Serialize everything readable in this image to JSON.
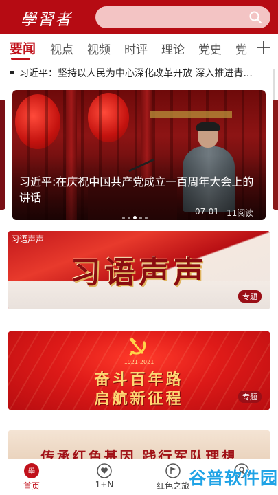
{
  "header": {
    "logo_text": "學習者",
    "search": {
      "placeholder": ""
    }
  },
  "tabs": [
    "要闻",
    "视点",
    "视频",
    "时评",
    "理论",
    "党史",
    "党"
  ],
  "active_tab": 0,
  "ticker": {
    "text": "习近平：坚持以人民为中心深化改革开放 深入推进青..."
  },
  "carousel": {
    "title": "习近平:在庆祝中国共产党成立一百周年大会上的讲话",
    "date": "07-01",
    "reads": "11阅读",
    "dot_count": 5,
    "active_dot": 2
  },
  "banners": [
    {
      "top_label": "习语声声",
      "headline": "习语声声",
      "badge": "专题"
    },
    {
      "years": "1921-2021",
      "line1": "奋斗百年路",
      "line2": "启航新征程",
      "badge": "专题"
    },
    {
      "headline": "传承红色基因 践行军队理想"
    }
  ],
  "bottom_nav": [
    {
      "label": "首页",
      "active": true,
      "icon": "home-logo-icon"
    },
    {
      "label": "1+N",
      "active": false,
      "icon": "heart-bubble-icon"
    },
    {
      "label": "红色之旅",
      "active": false,
      "icon": "flag-bubble-icon"
    },
    {
      "label": "",
      "active": false,
      "icon": "user-icon"
    }
  ],
  "watermark": {
    "text": "谷普软件园"
  },
  "colors": {
    "brand_red": "#b60b13",
    "accent_red": "#c1111b",
    "watermark_blue": "#1fa3e6"
  }
}
